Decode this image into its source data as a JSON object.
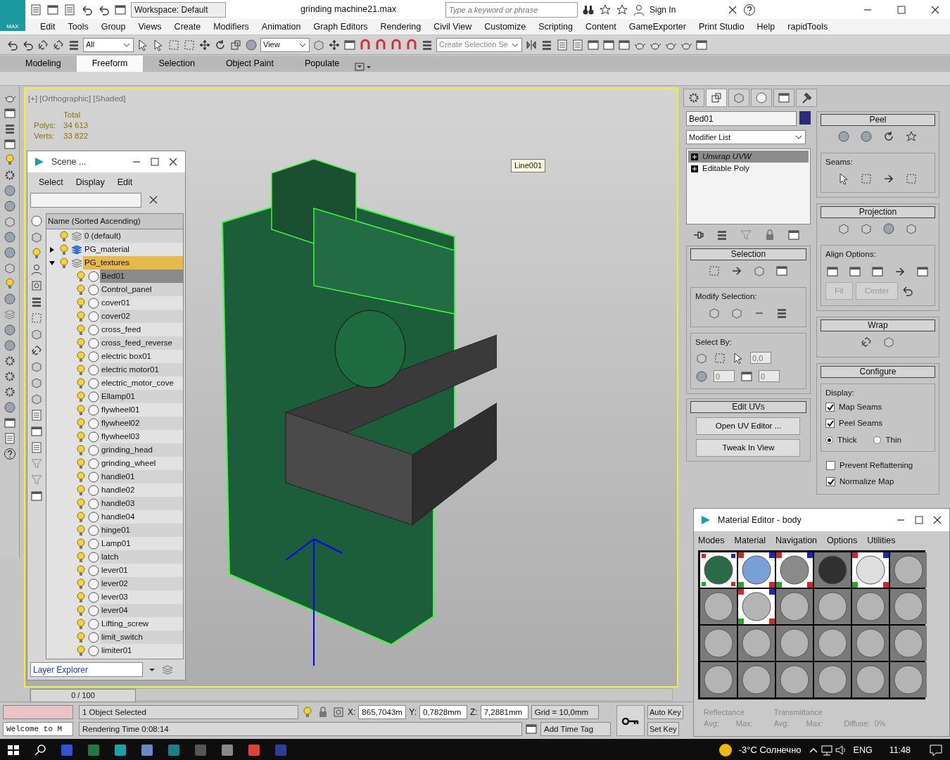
{
  "title_bar": {
    "logo": "MAX",
    "workspace": "Workspace: Default",
    "title": "grinding machine21.max",
    "search_placeholder": "Type a keyword or phrase",
    "sign_in": "Sign In"
  },
  "menu": [
    "Edit",
    "Tools",
    "Group",
    "Views",
    "Create",
    "Modifiers",
    "Animation",
    "Graph Editors",
    "Rendering",
    "Civil View",
    "Customize",
    "Scripting",
    "Content",
    "GameExporter",
    "Print Studio",
    "Help",
    "rapidTools"
  ],
  "main_toolbar": {
    "selection_filter": "All",
    "reference_coordinate": "View",
    "named_selection_placeholder": "Create Selection Se"
  },
  "ribbon_tabs": [
    {
      "label": "Modeling",
      "selected": false
    },
    {
      "label": "Freeform",
      "selected": true
    },
    {
      "label": "Selection",
      "selected": false
    },
    {
      "label": "Object Paint",
      "selected": false
    },
    {
      "label": "Populate",
      "selected": false
    }
  ],
  "viewport": {
    "label": "[+] [Orthographic] [Shaded]",
    "stats": {
      "heading": "Total",
      "rows": [
        {
          "label": "Polys:",
          "value": "34 613"
        },
        {
          "label": "Verts:",
          "value": "33 822"
        }
      ]
    },
    "object_tag": "Line001"
  },
  "scene_explorer": {
    "title": "Scene ...",
    "menu": [
      "Select",
      "Display",
      "Edit"
    ],
    "column": "Name (Sorted Ascending)",
    "layers": [
      {
        "name": "0 (default)",
        "expanded": false,
        "selected": false
      },
      {
        "name": "PG_material",
        "expanded": false,
        "selected": false,
        "has_children": true
      },
      {
        "name": "PG_textures",
        "expanded": true,
        "selected": true,
        "children": [
          {
            "name": "Bed01",
            "selected": true
          },
          {
            "name": "Control_panel",
            "selected": false
          },
          {
            "name": "cover01",
            "selected": false
          },
          {
            "name": "cover02",
            "selected": false
          },
          {
            "name": "cross_feed",
            "selected": false
          },
          {
            "name": "cross_feed_reverse",
            "selected": false
          },
          {
            "name": "electric box01",
            "selected": false
          },
          {
            "name": "electric motor01",
            "selected": false
          },
          {
            "name": "electric_motor_cove",
            "selected": false
          },
          {
            "name": "Ellamp01",
            "selected": false
          },
          {
            "name": "flywheel01",
            "selected": false
          },
          {
            "name": "flywheel02",
            "selected": false
          },
          {
            "name": "flywheel03",
            "selected": false
          },
          {
            "name": "grinding_head",
            "selected": false
          },
          {
            "name": "grinding_wheel",
            "selected": false
          },
          {
            "name": "handle01",
            "selected": false
          },
          {
            "name": "handle02",
            "selected": false
          },
          {
            "name": "handle03",
            "selected": false
          },
          {
            "name": "handle04",
            "selected": false
          },
          {
            "name": "hinge01",
            "selected": false
          },
          {
            "name": "Lamp01",
            "selected": false
          },
          {
            "name": "latch",
            "selected": false
          },
          {
            "name": "lever01",
            "selected": false
          },
          {
            "name": "lever02",
            "selected": false
          },
          {
            "name": "lever03",
            "selected": false
          },
          {
            "name": "lever04",
            "selected": false
          },
          {
            "name": "Lifting_screw",
            "selected": false
          },
          {
            "name": "limit_switch",
            "selected": false
          },
          {
            "name": "limiter01",
            "selected": false
          }
        ]
      }
    ],
    "explorer_type": "Layer Explorer"
  },
  "time_slider": {
    "label": "0 / 100",
    "level": 0
  },
  "command_panel": {
    "tabs": [
      {
        "selected": false
      },
      {
        "selected": true
      },
      {
        "selected": false
      },
      {
        "selected": false
      },
      {
        "selected": false
      },
      {
        "selected": false
      }
    ],
    "object_name": "Bed01",
    "modifier_list": "Modifier List",
    "stack": [
      {
        "label": "Unwrap UVW",
        "selected": true
      },
      {
        "label": "Editable Poly",
        "selected": false
      }
    ],
    "selection": {
      "title": "Selection",
      "modify_label": "Modify Selection:",
      "select_by_label": "Select By:",
      "angle": "0,0",
      "grow_value": "0",
      "loop_value": "0"
    },
    "edit_uvs": {
      "title": "Edit UVs",
      "buttons": [
        "Open UV Editor ...",
        "Tweak In View"
      ]
    },
    "peel": {
      "title": "Peel",
      "seams_label": "Seams:"
    },
    "projection": {
      "title": "Projection",
      "align_label": "Align Options:",
      "buttons": [
        "Fit",
        "Center"
      ]
    },
    "wrap": {
      "title": "Wrap"
    },
    "configure": {
      "title": "Configure",
      "display_label": "Display:",
      "checks": [
        {
          "label": "Map Seams",
          "checked": true
        },
        {
          "label": "Peel Seams",
          "checked": true
        }
      ],
      "radios": [
        {
          "label": "Thick",
          "selected": true
        },
        {
          "label": "Thin",
          "selected": false
        }
      ],
      "options": [
        {
          "label": "Prevent Reflattening",
          "checked": false
        },
        {
          "label": "Normalize Map",
          "checked": true
        }
      ]
    }
  },
  "material_editor": {
    "title": "Material Editor - body",
    "menu": [
      "Modes",
      "Material",
      "Navigation",
      "Options",
      "Utilities"
    ],
    "slots": [
      {
        "kind": "green",
        "checker_border": true,
        "selected": true
      },
      {
        "kind": "mosaic",
        "checker_border": true,
        "selected": false
      },
      {
        "kind": "rough",
        "checker_border": true,
        "selected": false
      },
      {
        "kind": "dark",
        "checker_border": false,
        "selected": false
      },
      {
        "kind": "bright",
        "checker_border": true,
        "selected": false
      },
      {
        "kind": "plain",
        "checker_border": false,
        "selected": false
      },
      {
        "kind": "plain",
        "checker_border": false,
        "selected": false
      },
      {
        "kind": "plain",
        "checker_border": true,
        "selected": false
      },
      {
        "kind": "plain",
        "checker_border": false,
        "selected": false
      },
      {
        "kind": "plain",
        "checker_border": false,
        "selected": false
      },
      {
        "kind": "plain",
        "checker_border": false,
        "selected": false
      },
      {
        "kind": "plain",
        "checker_border": false,
        "selected": false
      },
      {
        "kind": "plain",
        "checker_border": false,
        "selected": false
      },
      {
        "kind": "plain",
        "checker_border": false,
        "selected": false
      },
      {
        "kind": "plain",
        "checker_border": false,
        "selected": false
      },
      {
        "kind": "plain",
        "checker_border": false,
        "selected": false
      },
      {
        "kind": "plain",
        "checker_border": false,
        "selected": false
      },
      {
        "kind": "plain",
        "checker_border": false,
        "selected": false
      },
      {
        "kind": "plain",
        "checker_border": false,
        "selected": false
      },
      {
        "kind": "plain",
        "checker_border": false,
        "selected": false
      },
      {
        "kind": "plain",
        "checker_border": false,
        "selected": false
      },
      {
        "kind": "plain",
        "checker_border": false,
        "selected": false
      },
      {
        "kind": "plain",
        "checker_border": false,
        "selected": false
      },
      {
        "kind": "plain",
        "checker_border": false,
        "selected": false
      }
    ],
    "footer": {
      "reflectance": "Reflectance",
      "avg1": "Avg:",
      "max1": "Max:",
      "transmittance": "Transmittance",
      "avg2": "Avg:",
      "max2": "Max:",
      "diffuse": "Diffuse:  0%"
    }
  },
  "status_bar": {
    "listener": "Welcome to M",
    "prompt": "1 Object Selected",
    "render_time": "Rendering Time  0:08:14",
    "x_label": "X:",
    "x": "865,7043m",
    "y_label": "Y:",
    "y": "0,7828mm",
    "z_label": "Z:",
    "z": "7,2881mm",
    "grid": "Grid = 10,0mm",
    "add_time_tag": "Add Time Tag",
    "auto_key": "Auto Key",
    "set_key": "Set Key"
  },
  "taskbar": {
    "weather": "-3°C  Солнечно",
    "language": "ENG",
    "time": "11:48"
  }
}
